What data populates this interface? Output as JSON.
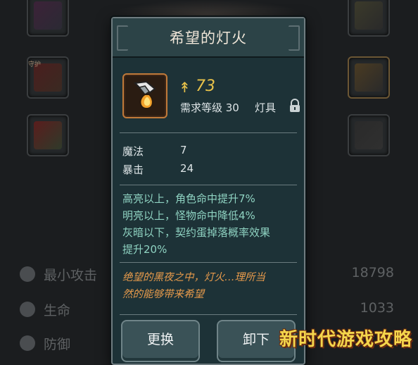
{
  "background": {
    "slot_tag": "守护",
    "stats": [
      {
        "icon": "sword-icon",
        "label": "最小攻击",
        "value": "18798"
      },
      {
        "icon": "heart-icon",
        "label": "生命",
        "value": "1033"
      },
      {
        "icon": "shield-icon",
        "label": "防御",
        "value": ""
      }
    ]
  },
  "popup": {
    "title": "希望的灯火",
    "item_icon": "lantern-icon",
    "power_icon": "power-icon",
    "power": "73",
    "requirement": "需求等级 30",
    "category": "灯具",
    "locked": true,
    "attributes": [
      {
        "name": "魔法",
        "value": "7"
      },
      {
        "name": "暴击",
        "value": "24"
      }
    ],
    "effects": [
      "高亮以上，角色命中提升7%",
      "明亮以上，怪物命中降低4%",
      "灰暗以下，契约蛋掉落概率效果",
      "提升20%"
    ],
    "lore": [
      "绝望的黑夜之中，灯火…理所当",
      "然的能够带来希望"
    ],
    "buttons": {
      "swap": "更换",
      "unequip": "卸下"
    }
  },
  "watermark": "新时代游戏攻略",
  "colors": {
    "panel_bg": "#1d3237",
    "title_bar": "#2c4347",
    "power": "#e8c24a",
    "effect_text": "#8fd3c2",
    "lore_text": "#e79a4b",
    "item_frame": "#c07a3a"
  }
}
